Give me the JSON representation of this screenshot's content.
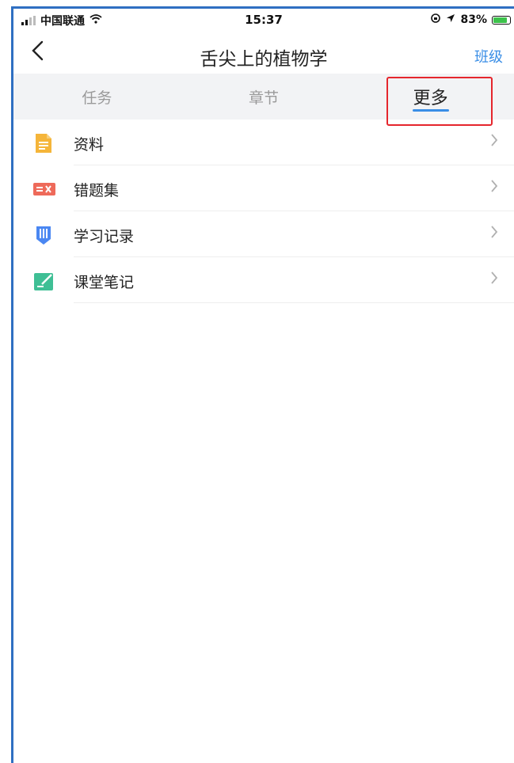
{
  "status_bar": {
    "carrier": "中国联通",
    "time": "15:37",
    "battery": "83%",
    "battery_level": 0.83
  },
  "nav": {
    "title": "舌尖上的植物学",
    "action_label": "班级"
  },
  "tabs": [
    {
      "label": "任务",
      "active": false
    },
    {
      "label": "章节",
      "active": false
    },
    {
      "label": "更多",
      "active": true
    }
  ],
  "menu": {
    "items": [
      {
        "label": "资料",
        "icon": "document-icon",
        "color": "#f5b53a"
      },
      {
        "label": "错题集",
        "icon": "error-book-icon",
        "color": "#ee6a5a"
      },
      {
        "label": "学习记录",
        "icon": "study-record-icon",
        "color": "#4a87f2"
      },
      {
        "label": "课堂笔记",
        "icon": "note-icon",
        "color": "#3fbf95"
      }
    ]
  },
  "colors": {
    "accent": "#3a8ee6",
    "highlight": "#e5262d",
    "tab_background": "#f2f3f5"
  }
}
